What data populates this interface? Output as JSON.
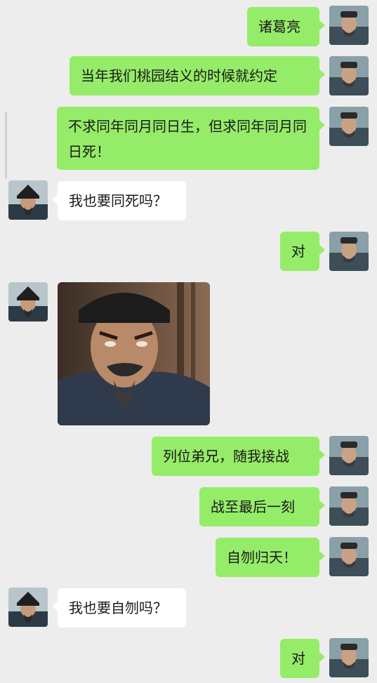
{
  "chat": {
    "messages": [
      {
        "side": "out",
        "text": "诸葛亮"
      },
      {
        "side": "out",
        "text": "当年我们桃园结义的时候就约定"
      },
      {
        "side": "out",
        "text": "不求同年同月同日生，但求同年同月同日死！"
      },
      {
        "side": "in",
        "text": "我也要同死吗？"
      },
      {
        "side": "out",
        "text": "对"
      },
      {
        "side": "in",
        "sticker": "angry-face-sticker"
      },
      {
        "side": "out",
        "text": "列位弟兄，随我接战"
      },
      {
        "side": "out",
        "text": "战至最后一刻"
      },
      {
        "side": "out",
        "text": "自刎归天！"
      },
      {
        "side": "in",
        "text": "我也要自刎吗？"
      },
      {
        "side": "out",
        "text": "对"
      }
    ]
  },
  "colors": {
    "background": "#ededed",
    "outgoing_bubble": "#95ec69",
    "incoming_bubble": "#ffffff"
  }
}
